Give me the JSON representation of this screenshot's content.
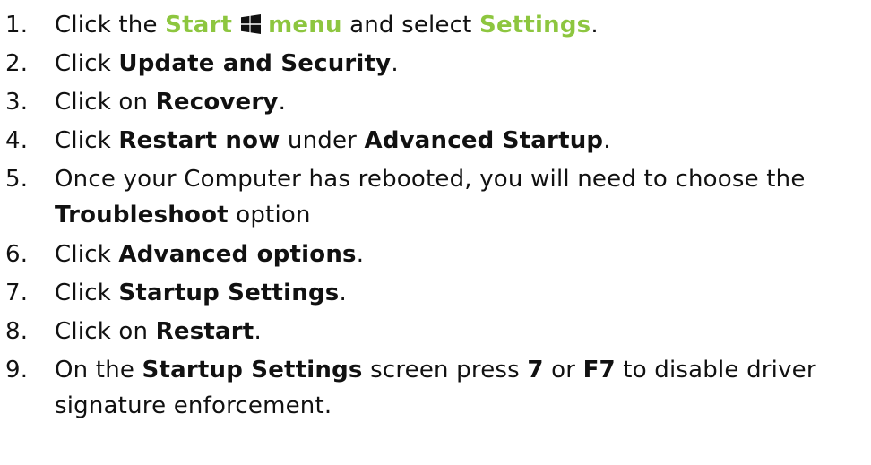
{
  "steps": [
    {
      "number": "1.",
      "text_a": "Click the ",
      "start_label": "Start",
      "icon": "windows-logo-icon",
      "menu_label": "menu",
      "text_b": " and select ",
      "settings_label": "Settings",
      "text_c": "."
    },
    {
      "number": "2.",
      "text_a": "Click ",
      "bold_a": "Update and Security",
      "text_b": "."
    },
    {
      "number": "3.",
      "text_a": "Click on ",
      "bold_a": "Recovery",
      "text_b": "."
    },
    {
      "number": "4.",
      "text_a": "Click ",
      "bold_a": "Restart now",
      "text_b": " under ",
      "bold_b": "Advanced Startup",
      "text_c": "."
    },
    {
      "number": "5.",
      "text_a": "Once your Computer has rebooted, you will need to choose the",
      "bold_a": "Troubleshoot",
      "text_b": " option"
    },
    {
      "number": "6.",
      "text_a": "Click ",
      "bold_a": "Advanced options",
      "text_b": "."
    },
    {
      "number": "7.",
      "text_a": "Click ",
      "bold_a": "Startup Settings",
      "text_b": "."
    },
    {
      "number": "8.",
      "text_a": "Click on ",
      "bold_a": "Restart",
      "text_b": "."
    },
    {
      "number": "9.",
      "text_a": "On the ",
      "bold_a": "Startup Settings",
      "text_b": " screen press ",
      "bold_b": "7",
      "text_c": " or ",
      "bold_c": "F7",
      "text_d": " to disable driver",
      "text_e": "signature enforcement."
    }
  ],
  "colors": {
    "accent": "#8dc63f",
    "text": "#111111",
    "background": "#ffffff"
  }
}
